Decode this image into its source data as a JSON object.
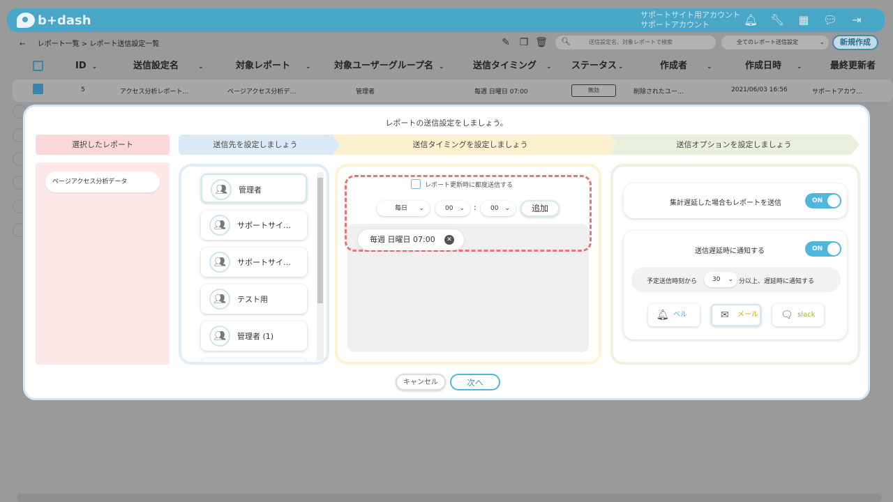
{
  "app": {
    "logo": "b+dash",
    "account_line1": "サポートサイト用アカウント",
    "account_line2": "サポートアカウント"
  },
  "breadcrumb": {
    "back": "←",
    "item1": "レポート一覧",
    "sep": ">",
    "item2": "レポート送信設定一覧"
  },
  "toolbar": {
    "search_placeholder": "送信設定名、対象レポートで検索",
    "filter_value": "全てのレポート送信設定",
    "new_label": "新規作成"
  },
  "table": {
    "columns": [
      "ID",
      "送信設定名",
      "対象レポート",
      "対象ユーザーグループ名",
      "送信タイミング",
      "ステータス",
      "作成者",
      "作成日時",
      "最終更新者"
    ],
    "row": {
      "id": "5",
      "name": "アクセス分析レポート…",
      "report": "ページアクセス分析デ…",
      "group": "管理者",
      "timing": "毎週 日曜日 07:00",
      "status": "無効",
      "creator": "削除されたユー…",
      "created": "2021/06/03 16:56",
      "updater": "サポートアカウ…"
    }
  },
  "modal": {
    "title": "レポートの送信設定をしましょう。",
    "steps": [
      "選択したレポート",
      "送信先を設定しましょう",
      "送信タイミングを設定しましょう",
      "送信オプションを設定しましょう"
    ],
    "selected_report": "ページアクセス分析データ",
    "destinations": [
      "管理者",
      "サポートサイ…",
      "サポートサイ…",
      "テスト用",
      "管理者 (1)"
    ],
    "timing": {
      "every_update_label": "レポート更新時に都度送信する",
      "frequency": "毎日",
      "hour": "00",
      "colon": ":",
      "minute": "00",
      "add_label": "追加",
      "chip": "毎週 日曜日 07:00"
    },
    "options": {
      "delay_send_label": "集計遅延した場合もレポートを送信",
      "delay_send_toggle": "ON",
      "notify_label": "送信遅延時に通知する",
      "notify_toggle": "ON",
      "delay_prefix": "予定送信時刻から",
      "delay_minutes": "30",
      "delay_suffix": "分以上、遅延時に通知する",
      "channels": [
        "ベル",
        "メール",
        "slack"
      ]
    },
    "cancel_label": "キャンセル",
    "next_label": "次へ"
  },
  "colors": {
    "accent": "#4fb6dc",
    "brand": "#4aa6c7",
    "dash": "#e8737a",
    "mail": "#d4a500",
    "slack": "#a3b800",
    "bell": "#4fb6dc"
  }
}
